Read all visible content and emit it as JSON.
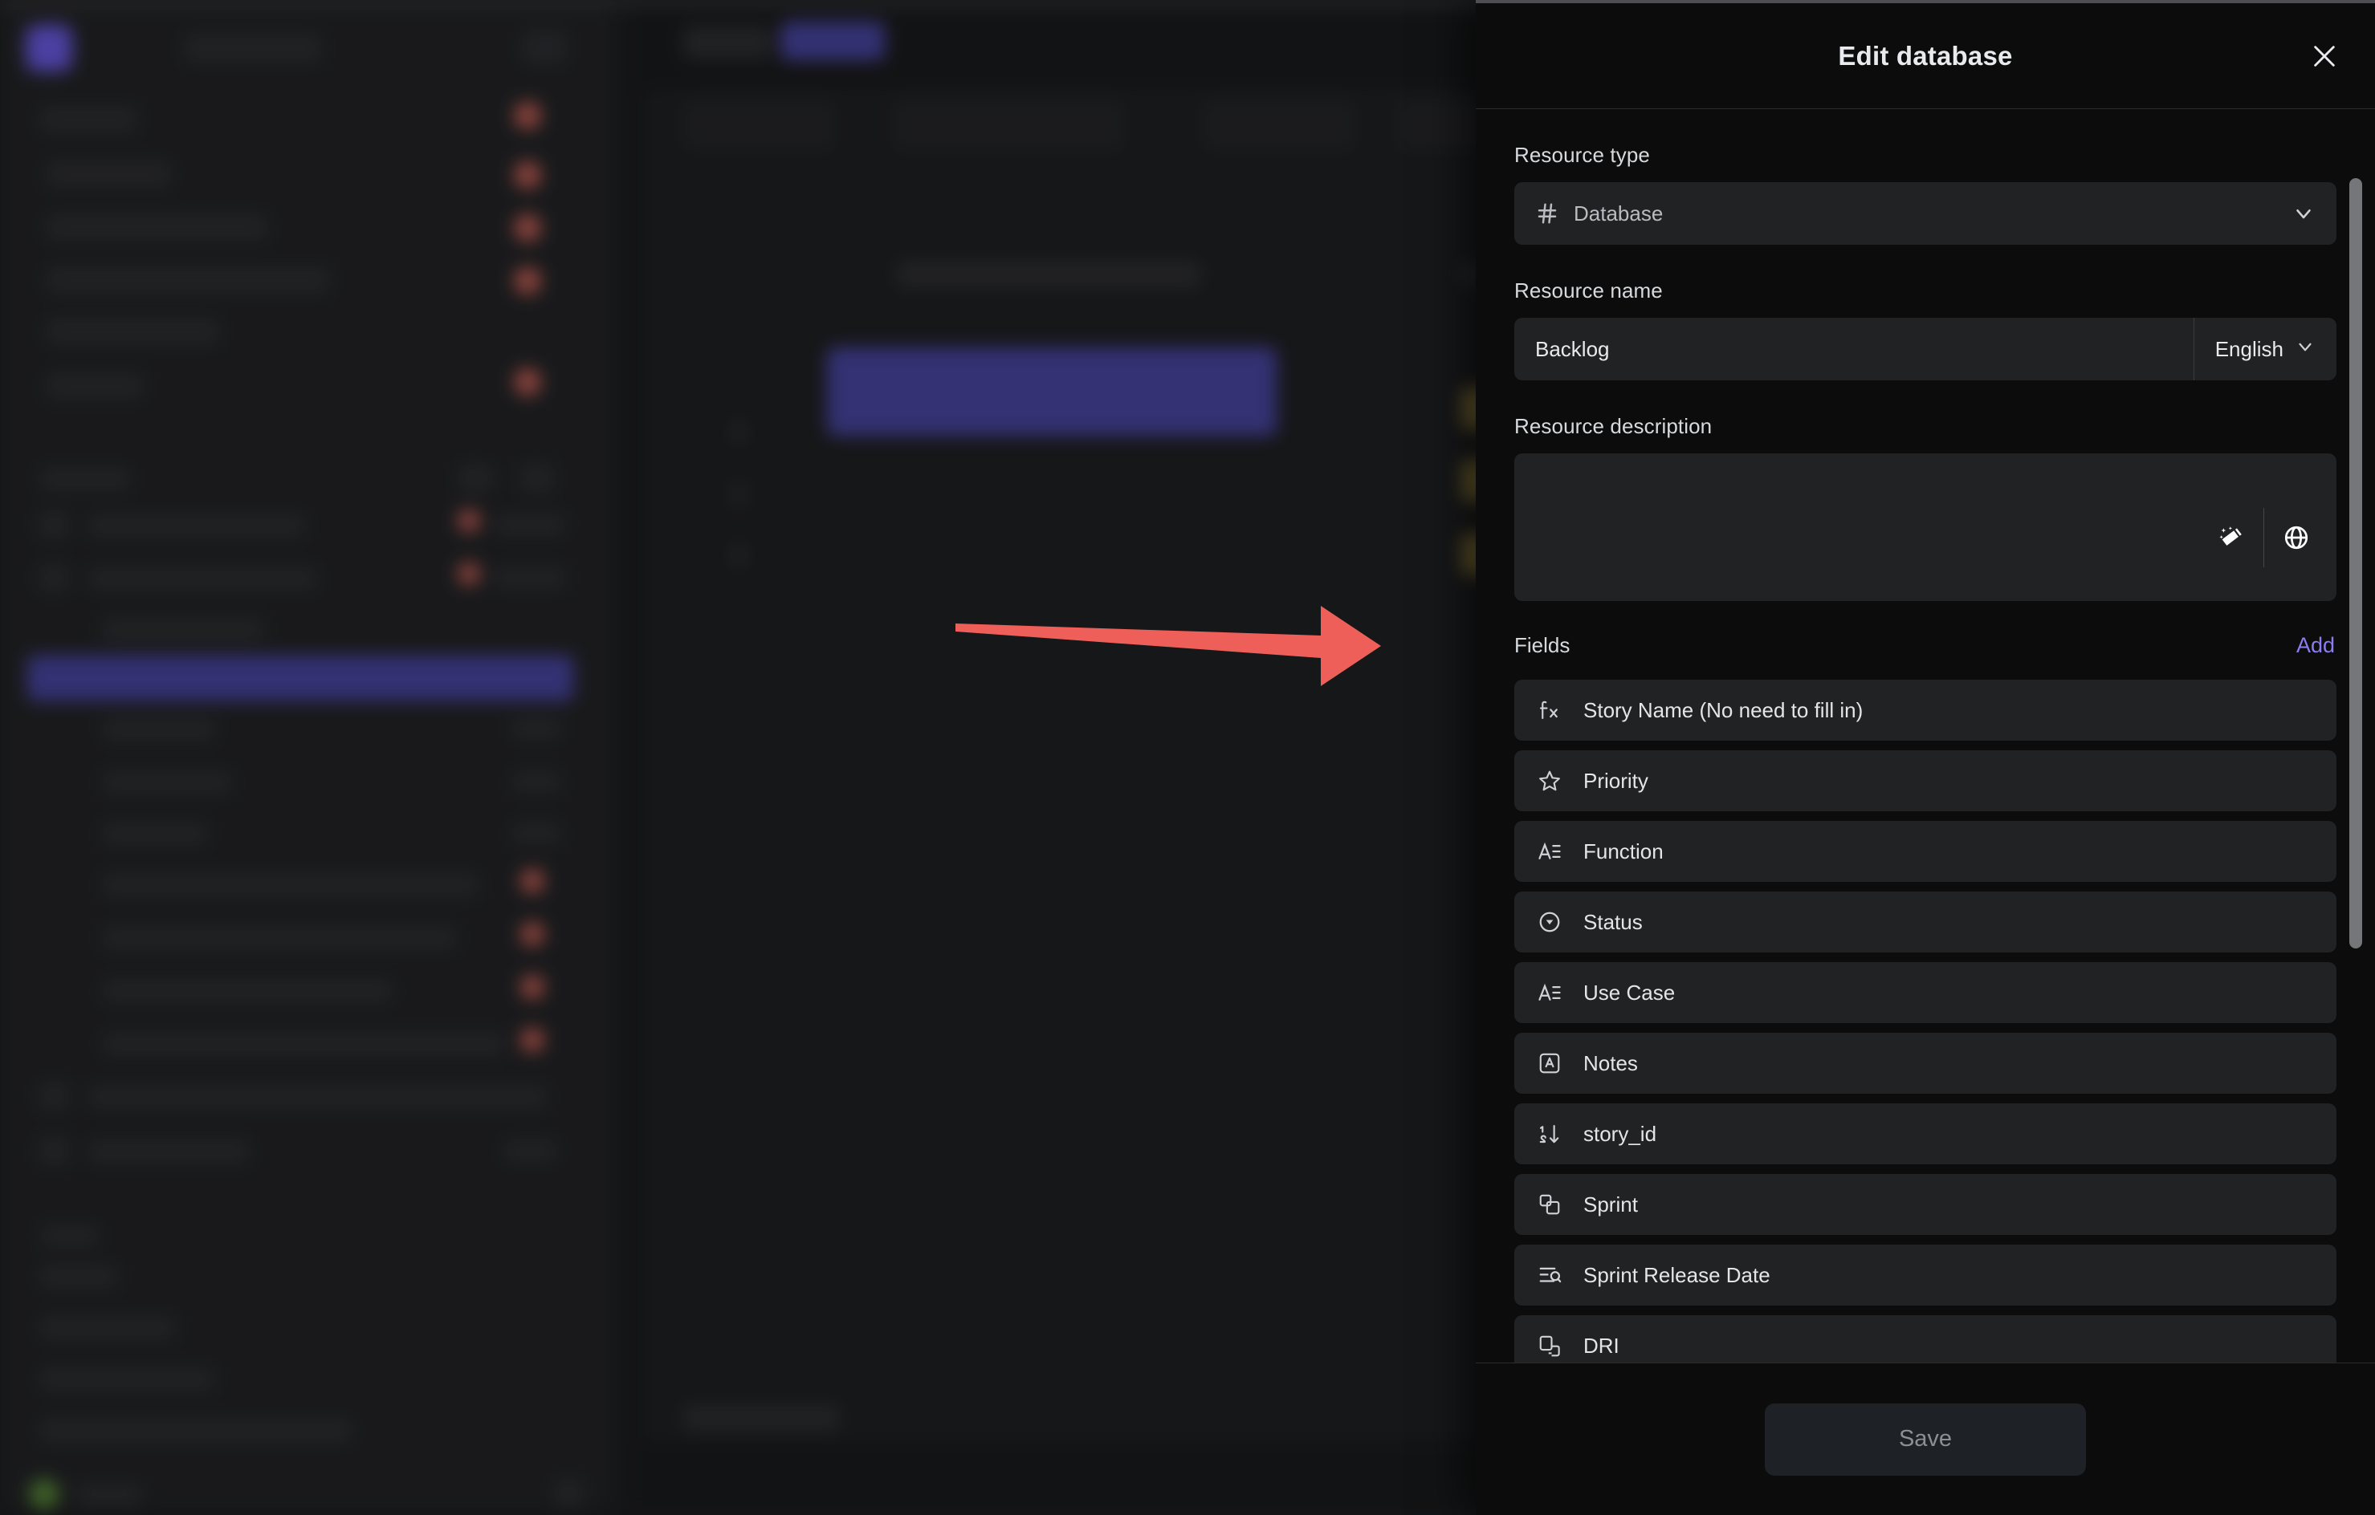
{
  "panel": {
    "title": "Edit database",
    "close_icon": "close-icon",
    "resource_type": {
      "label": "Resource type",
      "icon": "hash-icon",
      "value": "Database",
      "chevron_icon": "chevron-down-icon"
    },
    "resource_name": {
      "label": "Resource name",
      "value": "Backlog",
      "placeholder": "Resource name",
      "language": "English",
      "chevron_icon": "chevron-down-icon"
    },
    "resource_description": {
      "label": "Resource description",
      "value": "",
      "placeholder": "",
      "ai_icon": "magic-wand-icon",
      "translate_icon": "globe-icon"
    },
    "fields_section": {
      "label": "Fields",
      "add_label": "Add",
      "add_color": "#8b7cf0",
      "items": [
        {
          "name": "Story Name (No need to fill in)",
          "icon": "formula-fx-icon"
        },
        {
          "name": "Priority",
          "icon": "star-icon"
        },
        {
          "name": "Function",
          "icon": "text-lines-icon"
        },
        {
          "name": "Status",
          "icon": "select-circle-icon"
        },
        {
          "name": "Use Case",
          "icon": "text-lines-icon"
        },
        {
          "name": "Notes",
          "icon": "rich-text-icon"
        },
        {
          "name": "story_id",
          "icon": "number-sort-icon"
        },
        {
          "name": "Sprint",
          "icon": "relation-icon"
        },
        {
          "name": "Sprint Release Date",
          "icon": "lookup-icon"
        },
        {
          "name": "DRI",
          "icon": "relation-person-icon"
        }
      ]
    },
    "save_label": "Save",
    "scrollbar": "panel-scrollbar"
  },
  "annotation": {
    "arrow": "red-arrow-pointing-to-add",
    "color": "#ef5f5a"
  },
  "background": {
    "note": "blurred underlying workspace app"
  }
}
